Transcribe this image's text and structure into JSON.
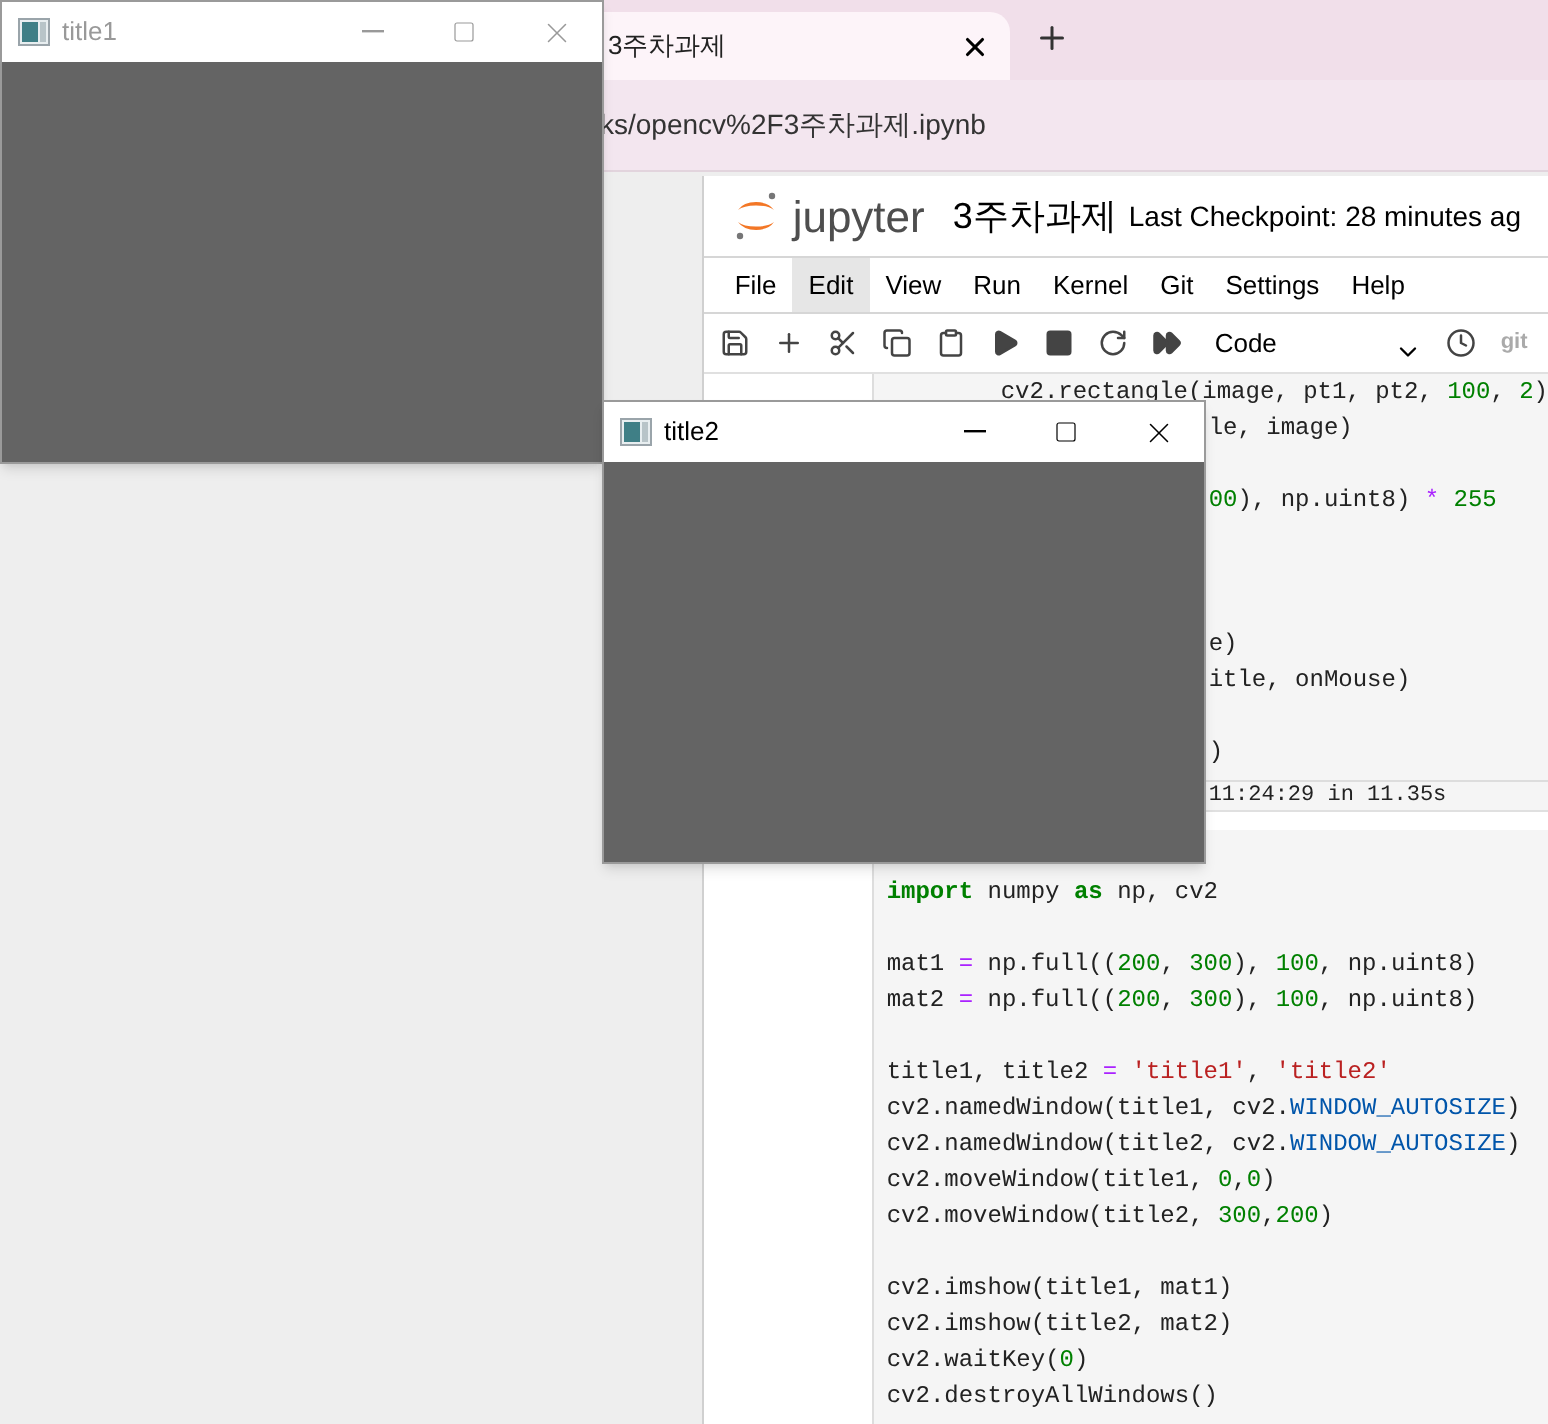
{
  "browser": {
    "tab": {
      "title": "3주차과제"
    },
    "address": "ks/opencv%2F3주차과제.ipynb"
  },
  "notebook": {
    "logo_text": "jupyter",
    "title": "3주차과제",
    "checkpoint": "Last Checkpoint: 28 minutes ag",
    "menu": [
      {
        "label": "File",
        "selected": false
      },
      {
        "label": "Edit",
        "selected": true
      },
      {
        "label": "View",
        "selected": false
      },
      {
        "label": "Run",
        "selected": false
      },
      {
        "label": "Kernel",
        "selected": false
      },
      {
        "label": "Git",
        "selected": false
      },
      {
        "label": "Settings",
        "selected": false
      },
      {
        "label": "Help",
        "selected": false
      }
    ],
    "cell_type": "Code",
    "git_label": "git",
    "cell1": {
      "lines": [
        {
          "kind": "indented",
          "text": "cv2.rectangle(image, pt1, pt2, 100, 2)"
        },
        {
          "kind": "clipped",
          "text": "le, image)"
        },
        {
          "kind": "blank"
        },
        {
          "kind": "clipped",
          "text": "00), np.uint8) * 255"
        },
        {
          "kind": "blank"
        },
        {
          "kind": "blank"
        },
        {
          "kind": "blank"
        },
        {
          "kind": "clipped",
          "text": "e)"
        },
        {
          "kind": "clipped",
          "text": "itle, onMouse)"
        },
        {
          "kind": "blank"
        },
        {
          "kind": "clipped",
          "text": ")"
        }
      ],
      "status": "11:24:29 in 11.35s"
    },
    "cell2": {
      "source": "import numpy as np, cv2\n\nmat1 = np.full((200, 300), 100, np.uint8)\nmat2 = np.full((200, 300), 100, np.uint8)\n\ntitle1, title2 = 'title1', 'title2'\ncv2.namedWindow(title1, cv2.WINDOW_AUTOSIZE)\ncv2.namedWindow(title2, cv2.WINDOW_AUTOSIZE)\ncv2.moveWindow(title1, 0,0)\ncv2.moveWindow(title2, 300,200)\n\ncv2.imshow(title1, mat1)\ncv2.imshow(title2, mat2)\ncv2.waitKey(0)\ncv2.destroyAllWindows()"
    }
  },
  "windows": [
    {
      "title": "title1",
      "active": false
    },
    {
      "title": "title2",
      "active": true
    }
  ]
}
